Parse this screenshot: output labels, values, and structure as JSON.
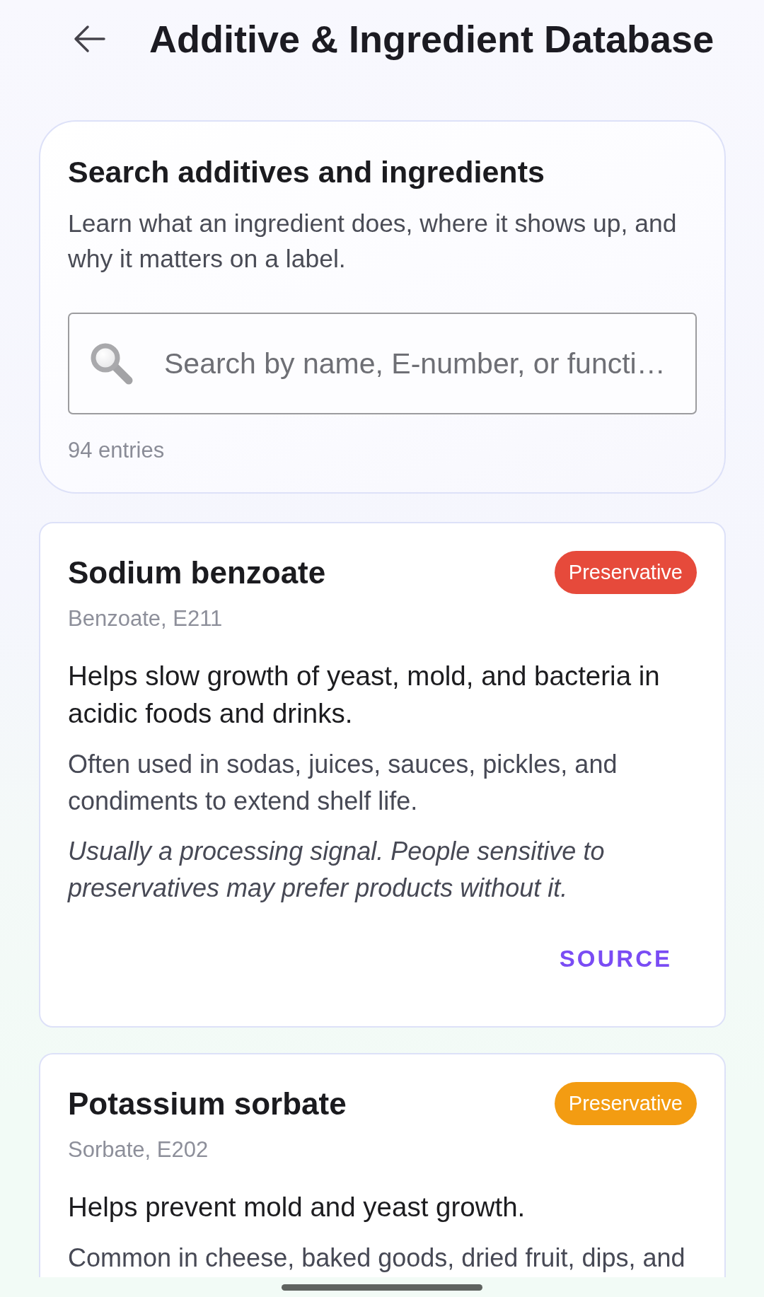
{
  "header": {
    "title": "Additive & Ingredient Database"
  },
  "search_card": {
    "title": "Search additives and ingredients",
    "description": "Learn what an ingredient does, where it shows up, and why it matters on a label.",
    "search": {
      "placeholder": "Search by name, E-number, or functi…"
    },
    "count": "94 entries"
  },
  "entries": [
    {
      "name": "Sodium benzoate",
      "aliases": "Benzoate, E211",
      "tag": "Preservative",
      "color": "#e64a3b",
      "description": "Helps slow growth of yeast, mold, and bacteria in acidic foods and drinks.",
      "usage": "Often used in sodas, juices, sauces, pickles, and condiments to extend shelf life.",
      "note": "Usually a processing signal. People sensitive to preservatives may prefer products without it.",
      "link": "SOURCE"
    },
    {
      "name": "Potassium sorbate",
      "aliases": "Sorbate, E202",
      "tag": "Preservative",
      "color": "#f39c12",
      "description": "Helps prevent mold and yeast growth.",
      "usage": "Common in cheese, baked goods, dried fruit, dips, and"
    }
  ]
}
